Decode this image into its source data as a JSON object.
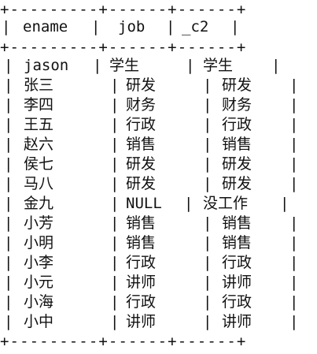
{
  "table": {
    "border_line": "+---------+------+------+",
    "pipe": "|",
    "headers": [
      "ename",
      "job",
      "_c2"
    ],
    "rows": [
      [
        "jason",
        "学生",
        "学生"
      ],
      [
        "张三",
        "研发",
        "研发"
      ],
      [
        "李四",
        "财务",
        "财务"
      ],
      [
        "王五",
        "行政",
        "行政"
      ],
      [
        "赵六",
        "销售",
        "销售"
      ],
      [
        "侯七",
        "研发",
        "研发"
      ],
      [
        "马八",
        "研发",
        "研发"
      ],
      [
        "金九",
        "NULL",
        "没工作"
      ],
      [
        "小芳",
        "销售",
        "销售"
      ],
      [
        "小明",
        "销售",
        "销售"
      ],
      [
        "小李",
        "行政",
        "行政"
      ],
      [
        "小元",
        "讲师",
        "讲师"
      ],
      [
        "小海",
        "行政",
        "行政"
      ],
      [
        "小中",
        "讲师",
        "讲师"
      ]
    ]
  }
}
